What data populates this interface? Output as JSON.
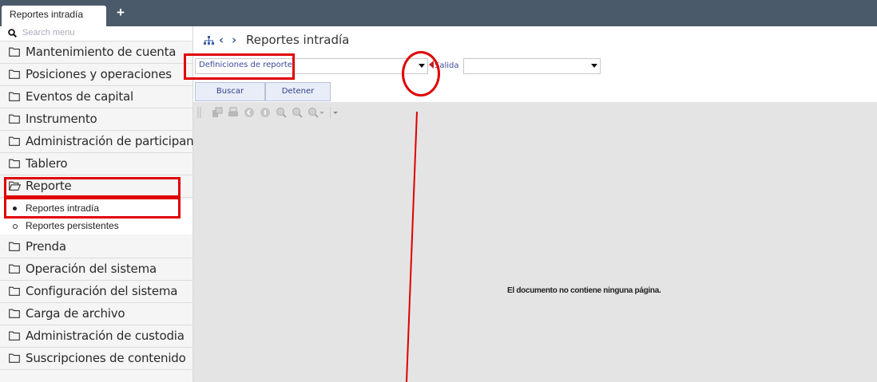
{
  "tabs": {
    "active_label": "Reportes intradía",
    "add_label": "+"
  },
  "search": {
    "placeholder": "Search menu"
  },
  "sidebar": {
    "items": [
      {
        "label": "Mantenimiento de cuenta"
      },
      {
        "label": "Posiciones y operaciones"
      },
      {
        "label": "Eventos de capital"
      },
      {
        "label": "Instrumento"
      },
      {
        "label": "Administración de participantes"
      },
      {
        "label": "Tablero"
      },
      {
        "label": "Reporte",
        "expanded": true
      },
      {
        "label": "Prenda"
      },
      {
        "label": "Operación del sistema"
      },
      {
        "label": "Configuración del sistema"
      },
      {
        "label": "Carga de archivo"
      },
      {
        "label": "Administración de custodia"
      },
      {
        "label": "Suscripciones de contenido"
      }
    ],
    "subitems": [
      {
        "label": "Reportes intradía",
        "selected": true
      },
      {
        "label": "Reportes persistentes",
        "selected": false
      }
    ]
  },
  "header": {
    "title": "Reportes intradía",
    "back_icon": "chevron-left-icon",
    "forward_icon": "chevron-right-icon",
    "sitemap_icon": "sitemap-icon"
  },
  "form": {
    "report_definitions_value": "Definiciones de reporte",
    "output_label": "Salida",
    "output_value": ""
  },
  "buttons": {
    "search_label": "Buscar",
    "stop_label": "Detener"
  },
  "viewer": {
    "empty_message": "El documento no contiene ninguna página."
  },
  "colors": {
    "topbar": "#4a5a6a",
    "accent_text": "#3a4a9a",
    "highlight": "#e00000",
    "viewer_bg": "#e4e4e4"
  }
}
